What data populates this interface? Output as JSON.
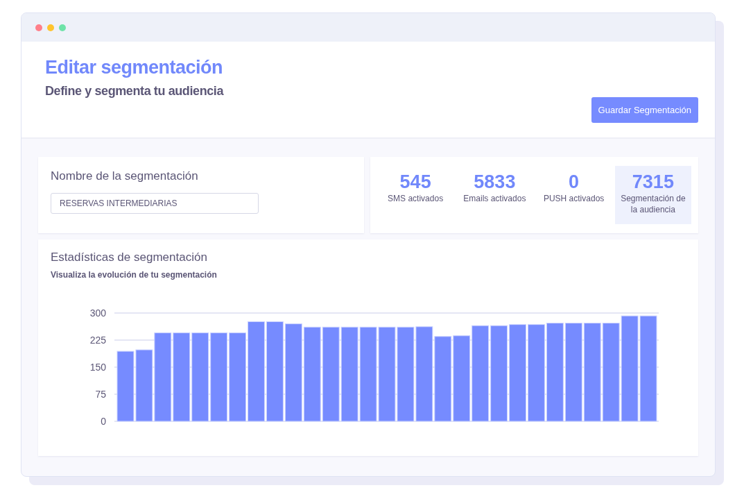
{
  "window": {
    "controls": [
      {
        "color": "#ff7f8a"
      },
      {
        "color": "#ffc42e"
      },
      {
        "color": "#6ee3a8"
      }
    ]
  },
  "header": {
    "title": "Editar segmentación",
    "subtitle": "Define y segmenta tu audiencia",
    "button": "Guardar Segmentación"
  },
  "name_card": {
    "label": "Nombre de la segmentación",
    "value": "RESERVAS INTERMEDIARIAS"
  },
  "stats": [
    {
      "value": "545",
      "label": "SMS activados",
      "selected": false
    },
    {
      "value": "5833",
      "label": "Emails activados",
      "selected": false
    },
    {
      "value": "0",
      "label": "PUSH activados",
      "selected": false
    },
    {
      "value": "7315",
      "label": "Segmentación de la audiencia",
      "selected": true
    }
  ],
  "statistics": {
    "title": "Estadísticas de segmentación",
    "subtitle": "Visualiza la evolución de tu segmentación",
    "chart_data": {
      "type": "bar",
      "grid": true,
      "ylim": [
        0,
        300
      ],
      "yticks": [
        0,
        75,
        150,
        225,
        300
      ],
      "series": [
        {
          "color": "#768bff",
          "values": [
            194,
            198,
            245,
            245,
            245,
            245,
            245,
            276,
            276,
            270,
            261,
            261,
            261,
            261,
            261,
            261,
            262,
            235,
            237,
            265,
            265,
            268,
            268,
            272,
            272,
            272,
            272,
            292,
            292
          ]
        }
      ]
    }
  }
}
